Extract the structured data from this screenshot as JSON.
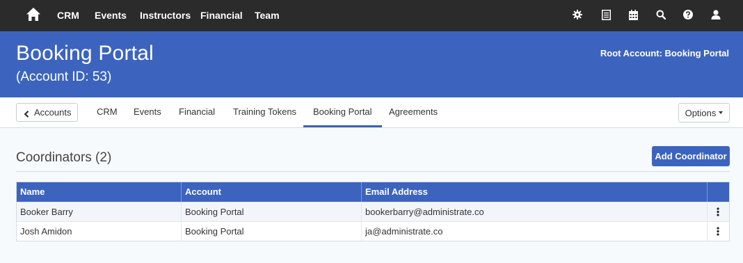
{
  "topnav": {
    "items": [
      {
        "label": "CRM"
      },
      {
        "label": "Events"
      },
      {
        "label": "Instructors"
      },
      {
        "label": "Financial"
      },
      {
        "label": "Team"
      }
    ],
    "icons": [
      "gear-icon",
      "list-icon",
      "calendar-icon",
      "search-icon",
      "help-icon",
      "user-icon"
    ]
  },
  "header": {
    "title": "Booking Portal",
    "subtitle": "(Account ID: 53)",
    "root_account": "Root Account: Booking Portal"
  },
  "subnav": {
    "back_label": "Accounts",
    "tabs": [
      {
        "label": "CRM"
      },
      {
        "label": "Events"
      },
      {
        "label": "Financial"
      },
      {
        "label": "Training Tokens"
      },
      {
        "label": "Booking Portal",
        "active": true
      },
      {
        "label": "Agreements"
      }
    ],
    "options_label": "Options"
  },
  "section": {
    "title": "Coordinators (2)",
    "add_button": "Add Coordinator"
  },
  "table": {
    "headers": [
      "Name",
      "Account",
      "Email Address"
    ],
    "rows": [
      [
        "Booker Barry",
        "Booking Portal",
        "bookerbarry@administrate.co"
      ],
      [
        "Josh Amidon",
        "Booking Portal",
        "ja@administrate.co"
      ]
    ]
  },
  "colors": {
    "topbar": "#2b2b2b",
    "brand_blue": "#3c64be",
    "page_bg": "#f7fafd"
  }
}
